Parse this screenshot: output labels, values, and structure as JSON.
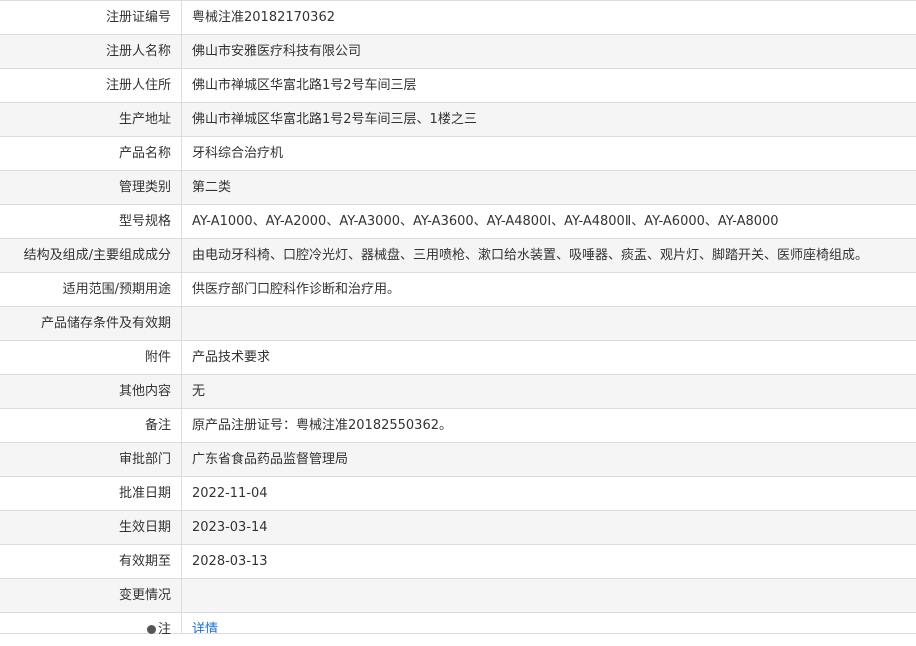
{
  "rows": [
    {
      "label": "注册证编号",
      "value": "粤械注准20182170362"
    },
    {
      "label": "注册人名称",
      "value": "佛山市安雅医疗科技有限公司"
    },
    {
      "label": "注册人住所",
      "value": "佛山市禅城区华富北路1号2号车间三层"
    },
    {
      "label": "生产地址",
      "value": "佛山市禅城区华富北路1号2号车间三层、1楼之三"
    },
    {
      "label": "产品名称",
      "value": "牙科综合治疗机"
    },
    {
      "label": "管理类别",
      "value": "第二类"
    },
    {
      "label": "型号规格",
      "value": "AY-A1000、AY-A2000、AY-A3000、AY-A3600、AY-A4800Ⅰ、AY-A4800Ⅱ、AY-A6000、AY-A8000"
    },
    {
      "label": "结构及组成/主要组成成分",
      "value": "由电动牙科椅、口腔冷光灯、器械盘、三用喷枪、漱口给水装置、吸唾器、痰盂、观片灯、脚踏开关、医师座椅组成。"
    },
    {
      "label": "适用范围/预期用途",
      "value": "供医疗部门口腔科作诊断和治疗用。"
    },
    {
      "label": "产品储存条件及有效期",
      "value": ""
    },
    {
      "label": "附件",
      "value": "产品技术要求"
    },
    {
      "label": "其他内容",
      "value": "无"
    },
    {
      "label": "备注",
      "value": "原产品注册证号：粤械注准20182550362。"
    },
    {
      "label": "审批部门",
      "value": "广东省食品药品监督管理局"
    },
    {
      "label": "批准日期",
      "value": "2022-11-04"
    },
    {
      "label": "生效日期",
      "value": "2023-03-14"
    },
    {
      "label": "有效期至",
      "value": "2028-03-13"
    },
    {
      "label": "变更情况",
      "value": ""
    }
  ],
  "note_row": {
    "label": "注",
    "value": "详情",
    "icon": "info-dot-icon"
  }
}
